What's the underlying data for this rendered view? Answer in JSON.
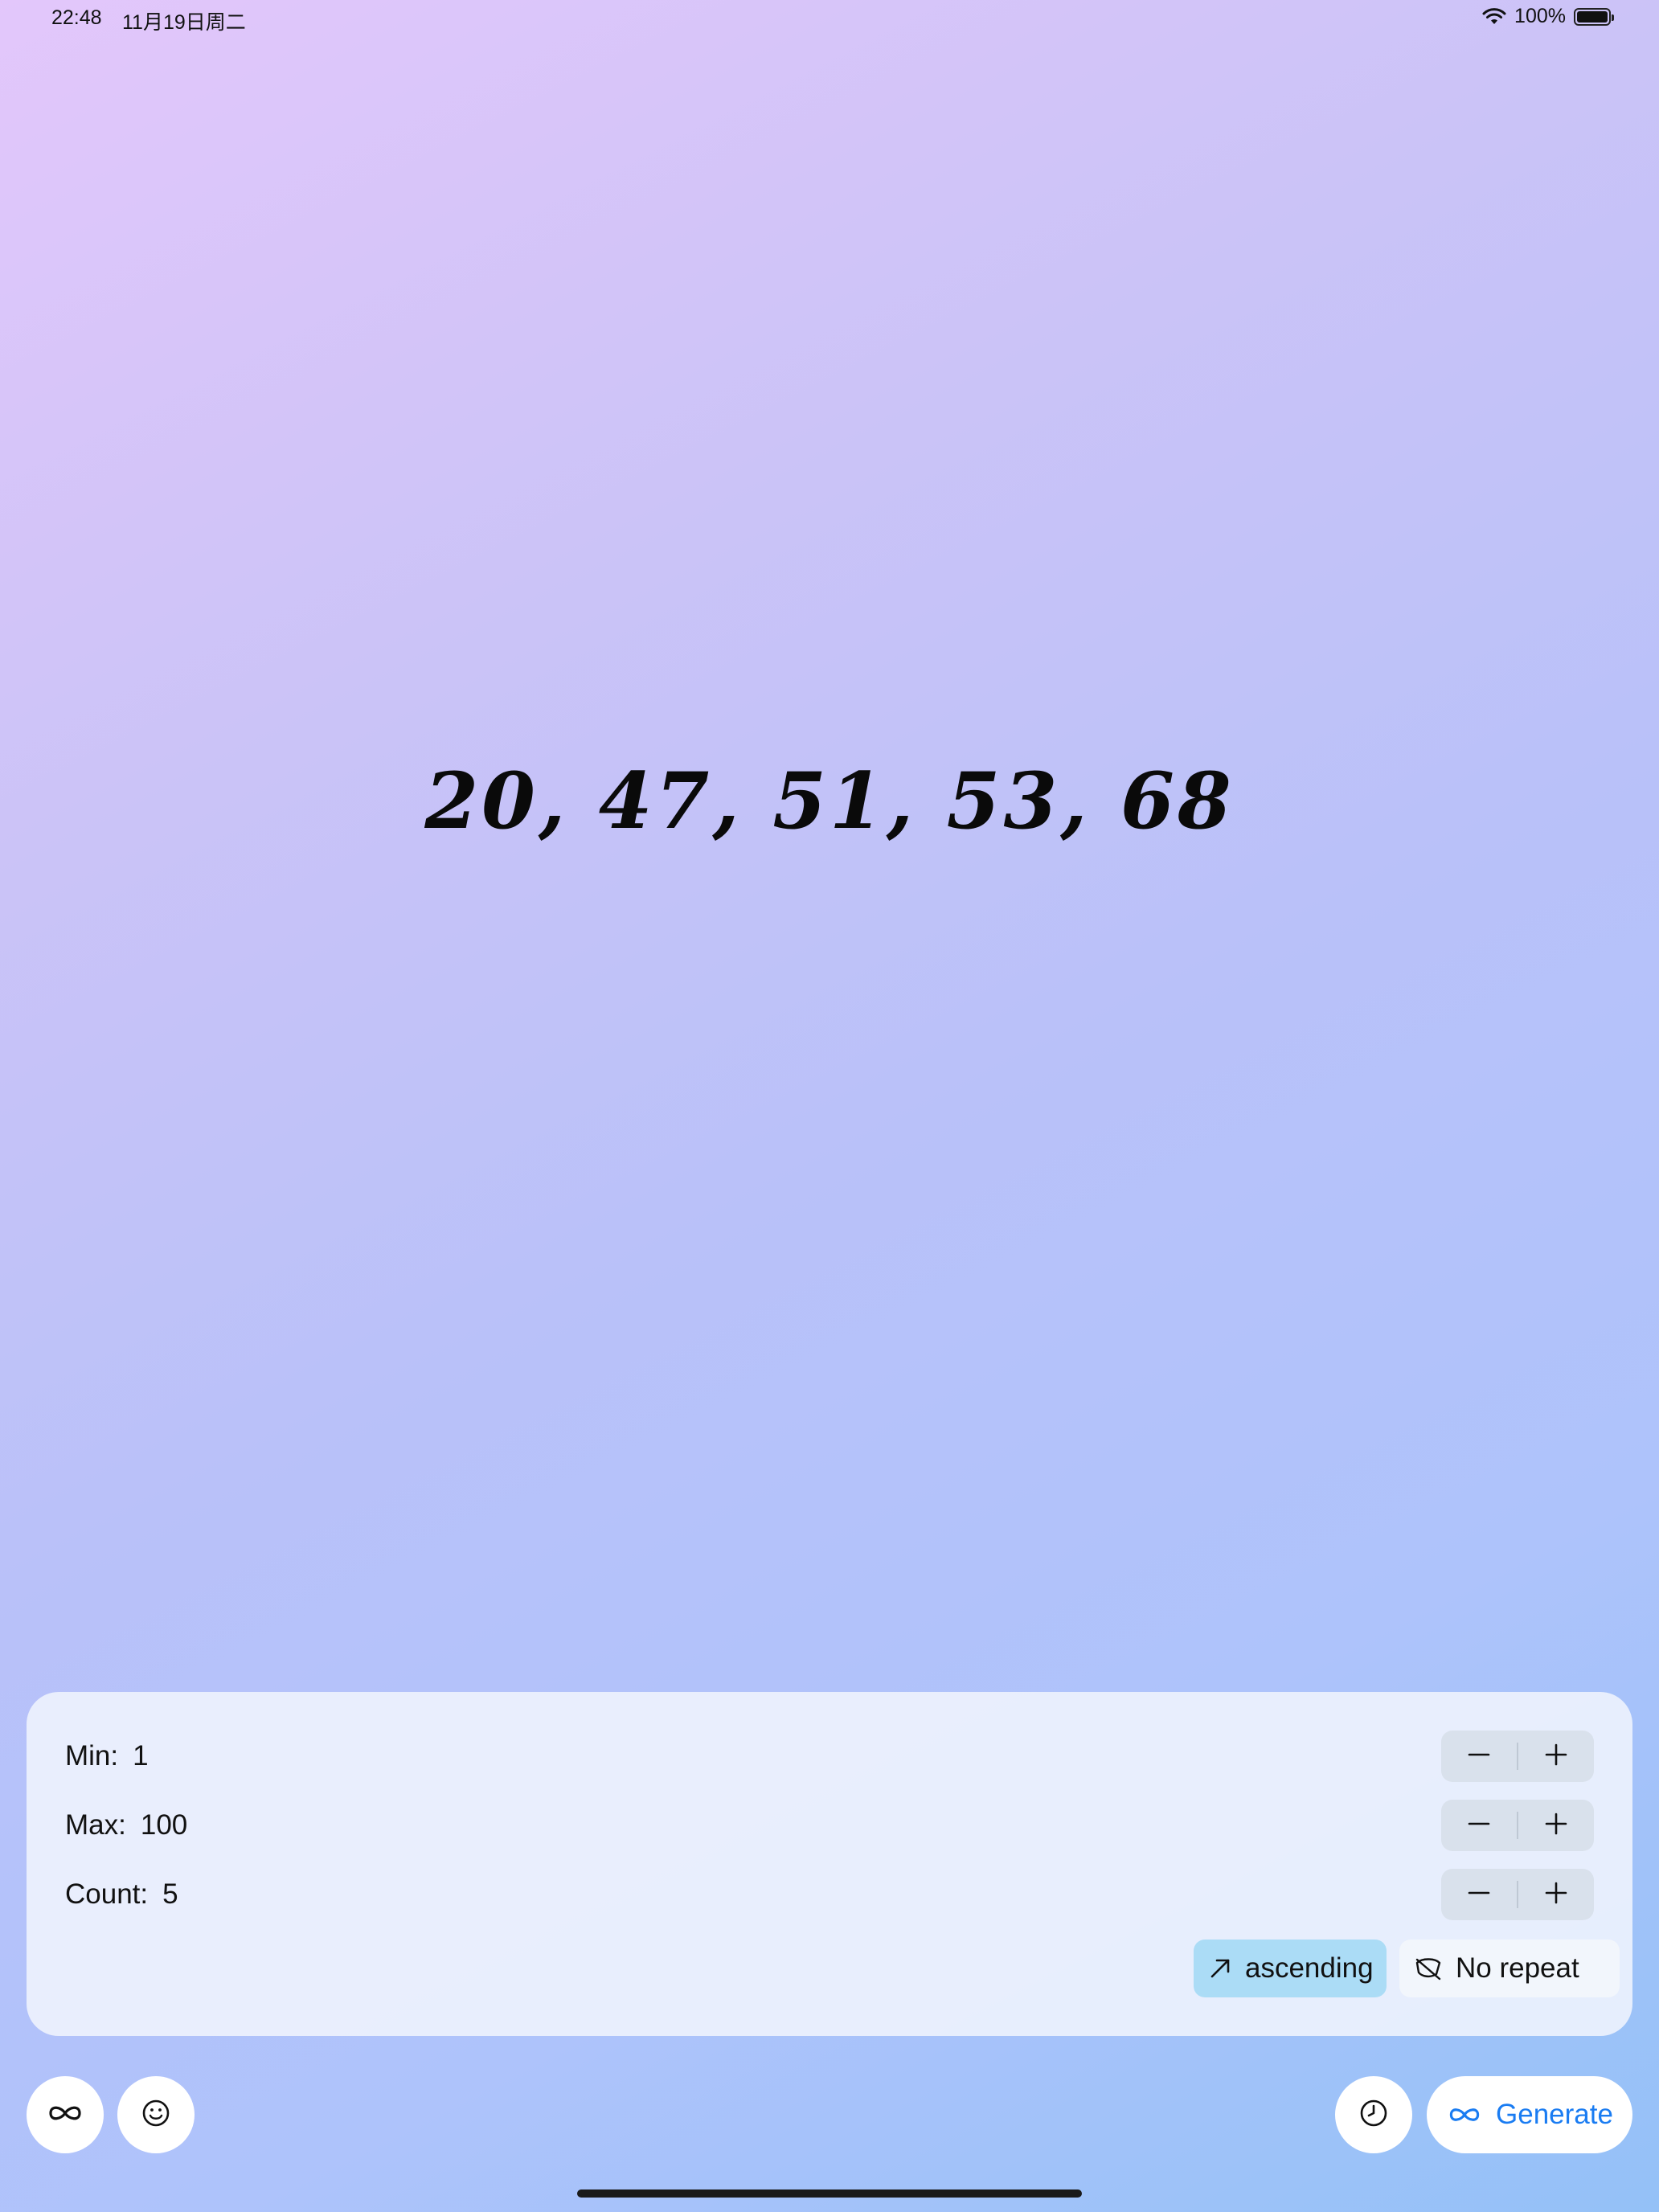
{
  "status_bar": {
    "time": "22:48",
    "date": "11月19日周二",
    "battery": "100%",
    "icons": [
      "wifi-icon",
      "battery-icon"
    ]
  },
  "result": {
    "numbers": "20, 47, 51, 53, 68"
  },
  "settings": {
    "min": {
      "label": "Min:",
      "value": "1"
    },
    "max": {
      "label": "Max:",
      "value": "100"
    },
    "count": {
      "label": "Count:",
      "value": "5"
    },
    "stepper_icons": [
      "minus-icon",
      "plus-icon"
    ],
    "sort_chip": {
      "label": "ascending",
      "icon": "arrow-up-right-icon",
      "selected": true
    },
    "repeat_chip": {
      "label": "No repeat",
      "icon": "no-repeat-icon",
      "selected": false
    }
  },
  "toolbar": {
    "left_buttons": [
      "infinity-icon",
      "smiley-icon"
    ],
    "history_icon": "clock-icon",
    "generate_label": "Generate",
    "generate_icon": "infinity-icon"
  },
  "colors": {
    "accent": "#1a7cf2",
    "chip_selected": "#abdcf6",
    "background_start": "#e3c7fb",
    "background_end": "#94c1f7"
  }
}
